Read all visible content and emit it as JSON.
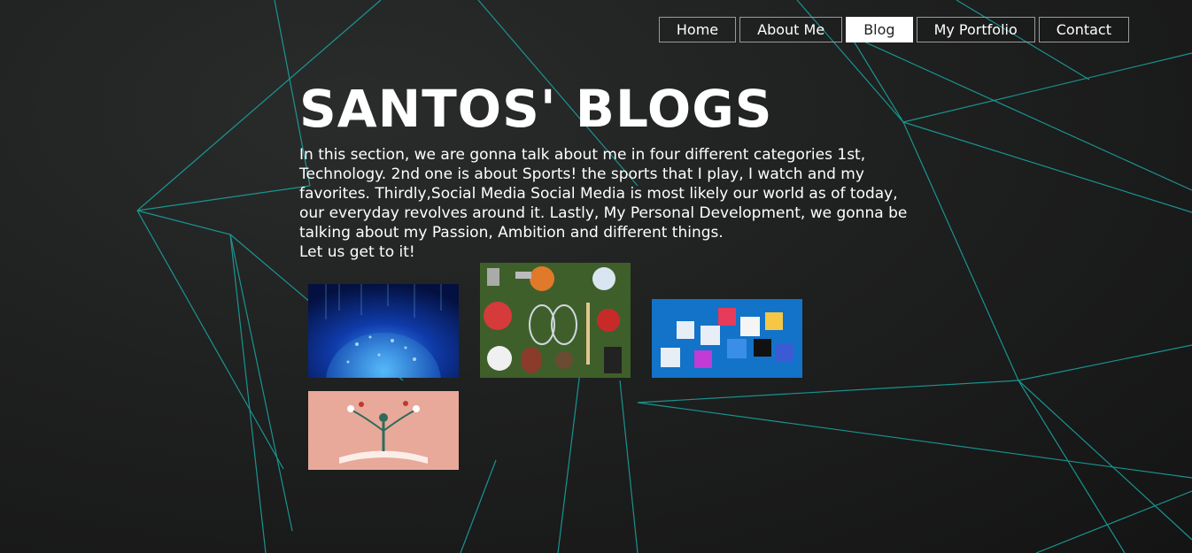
{
  "nav": {
    "items": [
      {
        "label": "Home"
      },
      {
        "label": "About Me"
      },
      {
        "label": "Blog"
      },
      {
        "label": "My Portfolio"
      },
      {
        "label": "Contact"
      }
    ],
    "active_index": 2
  },
  "header": {
    "title": "SANTOS' BLOGS"
  },
  "intro": {
    "paragraph": "In this section, we are gonna talk about me in four different categories 1st, Technology. 2nd one is about Sports! the sports that I play, I watch and my favorites. Thirdly,Social Media Social Media is most likely our world as of today, our everyday revolves around it. Lastly, My Personal Development, we gonna be talking about my Passion, Ambition and different things.",
    "closing": "Let us get to it!"
  },
  "thumbnails": [
    {
      "topic": "technology",
      "icon": "globe-network-image"
    },
    {
      "topic": "sports",
      "icon": "sports-equipment-image"
    },
    {
      "topic": "social-media",
      "icon": "social-media-cubes-image"
    },
    {
      "topic": "personal-development",
      "icon": "open-book-tree-image"
    }
  ],
  "colors": {
    "background": "#1c1c1c",
    "accent_lines": "#1fb5ad",
    "active_nav_bg": "#ffffff"
  }
}
